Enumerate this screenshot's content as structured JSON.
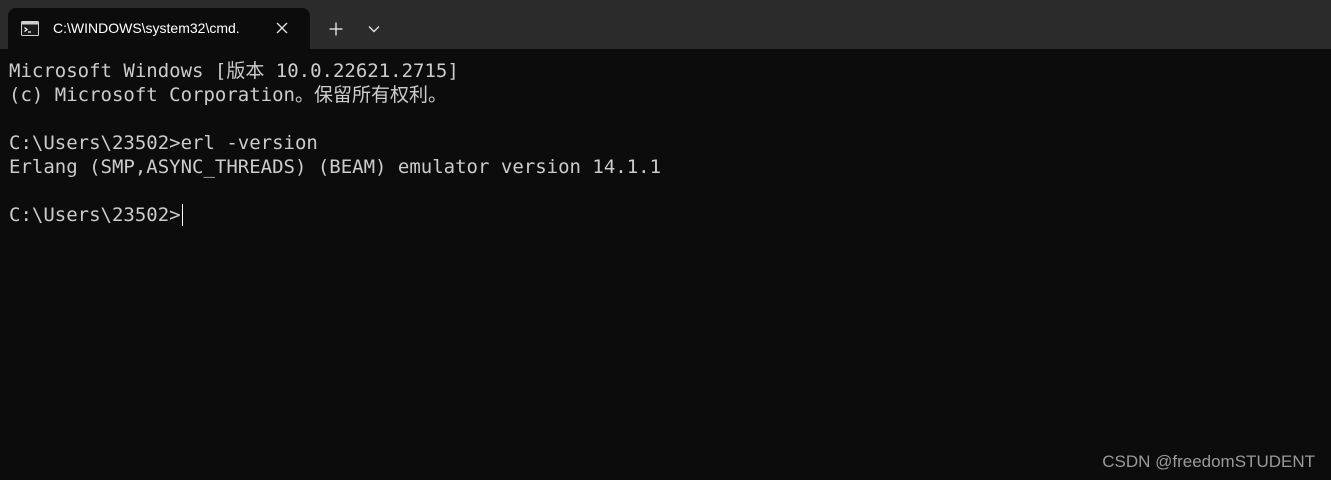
{
  "tab": {
    "title": "C:\\WINDOWS\\system32\\cmd.",
    "icon": "terminal-icon"
  },
  "tab_controls": {
    "close_icon": "close-icon",
    "new_tab_icon": "plus-icon",
    "dropdown_icon": "chevron-down-icon"
  },
  "terminal": {
    "lines": [
      "Microsoft Windows [版本 10.0.22621.2715]",
      "(c) Microsoft Corporation。保留所有权利。",
      "",
      "C:\\Users\\23502>erl -version",
      "Erlang (SMP,ASYNC_THREADS) (BEAM) emulator version 14.1.1",
      "",
      "C:\\Users\\23502>"
    ]
  },
  "watermark": "CSDN @freedomSTUDENT",
  "colors": {
    "tabbar_bg": "#2b2b2b",
    "terminal_bg": "#0c0c0c",
    "text": "#cccccc"
  }
}
